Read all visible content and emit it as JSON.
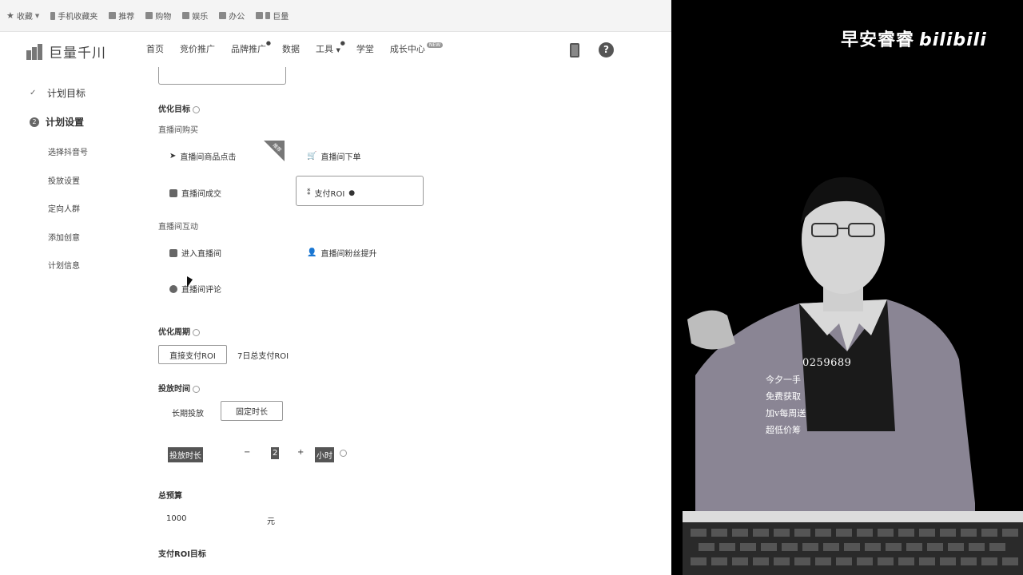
{
  "bookmarks": [
    {
      "label": "收藏",
      "icon": "star-icon"
    },
    {
      "label": "手机收藏夹",
      "icon": "mobile-icon"
    },
    {
      "label": "推荐",
      "icon": "folder-icon"
    },
    {
      "label": "购物",
      "icon": "folder-icon"
    },
    {
      "label": "娱乐",
      "icon": "folder-icon"
    },
    {
      "label": "办公",
      "icon": "folder-icon"
    },
    {
      "label": "巨量",
      "icon": "page-icon"
    }
  ],
  "header": {
    "logo_text": "巨量千川",
    "nav": [
      "首页",
      "竞价推广",
      "品牌推广",
      "数据",
      "工具",
      "学堂",
      "成长中心"
    ],
    "growth_badge": "NEW"
  },
  "sidebar": {
    "steps": [
      {
        "label": "计划目标",
        "state": "done"
      },
      {
        "label": "计划设置",
        "state": "current",
        "num": "2"
      }
    ],
    "subitems": [
      "选择抖音号",
      "投放设置",
      "定向人群",
      "添加创意",
      "计划信息"
    ]
  },
  "form": {
    "optimize_goal": {
      "title": "优化目标",
      "group1_title": "直播间购买",
      "group1_options": [
        "直播间商品点击",
        "直播间下单",
        "直播间成交",
        "支付ROI"
      ],
      "hot_tag": "推荐",
      "group2_title": "直播间互动",
      "group2_options": [
        "进入直播间",
        "直播间粉丝提升",
        "直播间评论"
      ]
    },
    "optimize_period": {
      "title": "优化周期",
      "options": [
        "直接支付ROI",
        "7日总支付ROI"
      ]
    },
    "delivery_time": {
      "title": "投放时间",
      "options": [
        "长期投放",
        "固定时长"
      ],
      "duration_label": "投放时长",
      "minus": "−",
      "value": "2",
      "plus": "+",
      "unit": "小时"
    },
    "budget": {
      "title": "总预算",
      "value": "1000",
      "unit": "元"
    },
    "roi_goal": {
      "title": "支付ROI目标"
    }
  },
  "video": {
    "watermark": "早安睿睿",
    "bili_logo": "bilibili",
    "overlay_lines": [
      "今夕一手",
      "免费获取",
      "加v每周送",
      "超低价筹"
    ],
    "phone_partial": "0259689"
  }
}
